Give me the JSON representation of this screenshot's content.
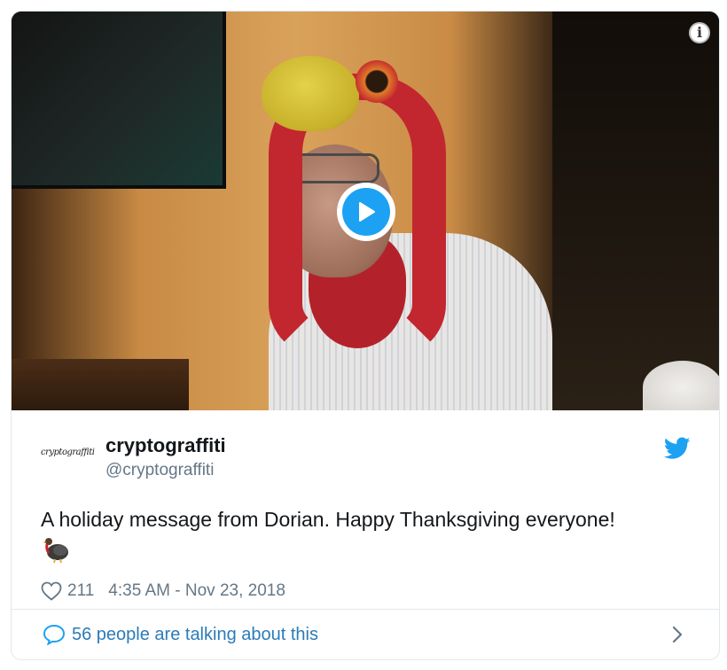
{
  "media": {
    "type": "video",
    "info_icon": "info-icon",
    "play_icon": "play-icon"
  },
  "author": {
    "avatar_text": "cryptograffiti",
    "name": "cryptograffiti",
    "handle": "@cryptograffiti"
  },
  "tweet": {
    "text": "A holiday message from Dorian.  Happy Thanksgiving everyone!",
    "emoji": "turkey-emoji"
  },
  "stats": {
    "likes": "211",
    "timestamp": "4:35 AM - Nov 23, 2018"
  },
  "footer": {
    "talking_label": "56 people are talking about this"
  },
  "colors": {
    "brand_blue": "#1da1f2",
    "link_blue": "#2b7bb9",
    "secondary_text": "#657786",
    "border": "#e1e8ed"
  }
}
